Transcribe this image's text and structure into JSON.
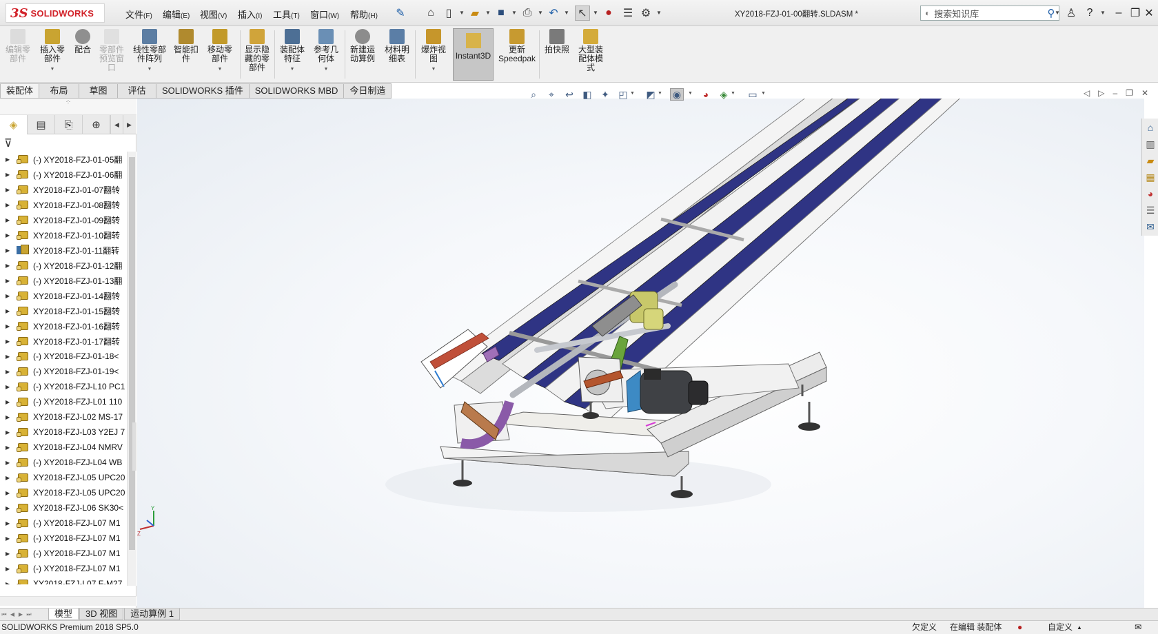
{
  "app": {
    "brand_ds": "3S",
    "brand_name": "SOLIDWORKS",
    "document_title": "XY2018-FZJ-01-00翻转.SLDASM *"
  },
  "menus": [
    {
      "label": "文件",
      "key": "(F)"
    },
    {
      "label": "编辑",
      "key": "(E)"
    },
    {
      "label": "视图",
      "key": "(V)"
    },
    {
      "label": "插入",
      "key": "(I)"
    },
    {
      "label": "工具",
      "key": "(T)"
    },
    {
      "label": "窗口",
      "key": "(W)"
    },
    {
      "label": "帮助",
      "key": "(H)"
    }
  ],
  "search": {
    "placeholder": "搜索知识库"
  },
  "ribbon": {
    "edit_component": "编辑零部件",
    "insert_components": "插入零部件",
    "mate": "配合",
    "component_preview": "零部件预览窗口",
    "linear_pattern": "线性零部件阵列",
    "smart_fasteners": "智能扣件",
    "move_component": "移动零部件",
    "show_hidden": "显示隐藏的零部件",
    "assembly_features": "装配体特征",
    "reference_geometry": "参考几何体",
    "new_motion_study": "新建运动算例",
    "bom": "材料明细表",
    "exploded_view": "爆炸视图",
    "instant3d": "Instant3D",
    "update_speedpak_1": "更新",
    "update_speedpak_2": "Speedpak",
    "snapshot": "拍快照",
    "large_assembly": "大型装配体模式"
  },
  "command_tabs": [
    "装配体",
    "布局",
    "草图",
    "评估",
    "SOLIDWORKS 插件",
    "SOLIDWORKS MBD",
    "今日制造"
  ],
  "feature_tree": [
    {
      "name": "(-) XY2018-FZJ-01-05翻",
      "icon": "part-yellow",
      "scroll_up": true
    },
    {
      "name": "(-) XY2018-FZJ-01-06翻",
      "icon": "part-yellow"
    },
    {
      "name": "XY2018-FZJ-01-07翻转",
      "icon": "part-yellow"
    },
    {
      "name": "XY2018-FZJ-01-08翻转",
      "icon": "part-yellow"
    },
    {
      "name": "XY2018-FZJ-01-09翻转",
      "icon": "part-yellow"
    },
    {
      "name": "XY2018-FZJ-01-10翻转",
      "icon": "part-yellow"
    },
    {
      "name": "XY2018-FZJ-01-11翻转",
      "icon": "part-multi"
    },
    {
      "name": "(-) XY2018-FZJ-01-12翻",
      "icon": "part-yellow"
    },
    {
      "name": "(-) XY2018-FZJ-01-13翻",
      "icon": "part-yellow"
    },
    {
      "name": "XY2018-FZJ-01-14翻转",
      "icon": "part-yellow"
    },
    {
      "name": "XY2018-FZJ-01-15翻转",
      "icon": "part-yellow"
    },
    {
      "name": "XY2018-FZJ-01-16翻转",
      "icon": "part-yellow"
    },
    {
      "name": "XY2018-FZJ-01-17翻转",
      "icon": "part-yellow"
    },
    {
      "name": "(-) XY2018-FZJ-01-18<",
      "icon": "part-yellow"
    },
    {
      "name": "(-) XY2018-FZJ-01-19<",
      "icon": "part-yellow"
    },
    {
      "name": "(-) XY2018-FZJ-L10 PC1",
      "icon": "part-yellow"
    },
    {
      "name": "(-) XY2018-FZJ-L01 110",
      "icon": "part-yellow"
    },
    {
      "name": "XY2018-FZJ-L02 MS-17",
      "icon": "part-yellow"
    },
    {
      "name": "XY2018-FZJ-L03 Y2EJ 7",
      "icon": "part-yellow"
    },
    {
      "name": "XY2018-FZJ-L04 NMRV",
      "icon": "part-yellow"
    },
    {
      "name": "(-) XY2018-FZJ-L04 WB",
      "icon": "part-yellow"
    },
    {
      "name": "XY2018-FZJ-L05 UPC20",
      "icon": "part-yellow"
    },
    {
      "name": "XY2018-FZJ-L05 UPC20",
      "icon": "part-yellow"
    },
    {
      "name": "XY2018-FZJ-L06 SK30<",
      "icon": "part-yellow"
    },
    {
      "name": "(-) XY2018-FZJ-L07 M1",
      "icon": "part-yellow"
    },
    {
      "name": "(-) XY2018-FZJ-L07 M1",
      "icon": "part-yellow"
    },
    {
      "name": "(-) XY2018-FZJ-L07 M1",
      "icon": "part-yellow"
    },
    {
      "name": "(-) XY2018-FZJ-L07 M1",
      "icon": "part-yellow"
    },
    {
      "name": "XY2018-FZJ-L07 F-M27",
      "icon": "part-yellow"
    }
  ],
  "model_tabs": [
    "模型",
    "3D 视图",
    "运动算例 1"
  ],
  "status": {
    "product": "SOLIDWORKS Premium 2018 SP5.0",
    "under_defined": "欠定义",
    "editing": "在编辑 装配体",
    "units": "自定义"
  },
  "colors": {
    "brand_red": "#d2232a",
    "belt_blue": "#2f3484",
    "frame_white": "#f2f2f2",
    "motor_blue": "#4a86b8",
    "arm_purple": "#8a5aa8",
    "cylinder_yellow": "#c8c86a",
    "link_green": "#6aa43c",
    "active_tab": "#c6c6c6"
  }
}
